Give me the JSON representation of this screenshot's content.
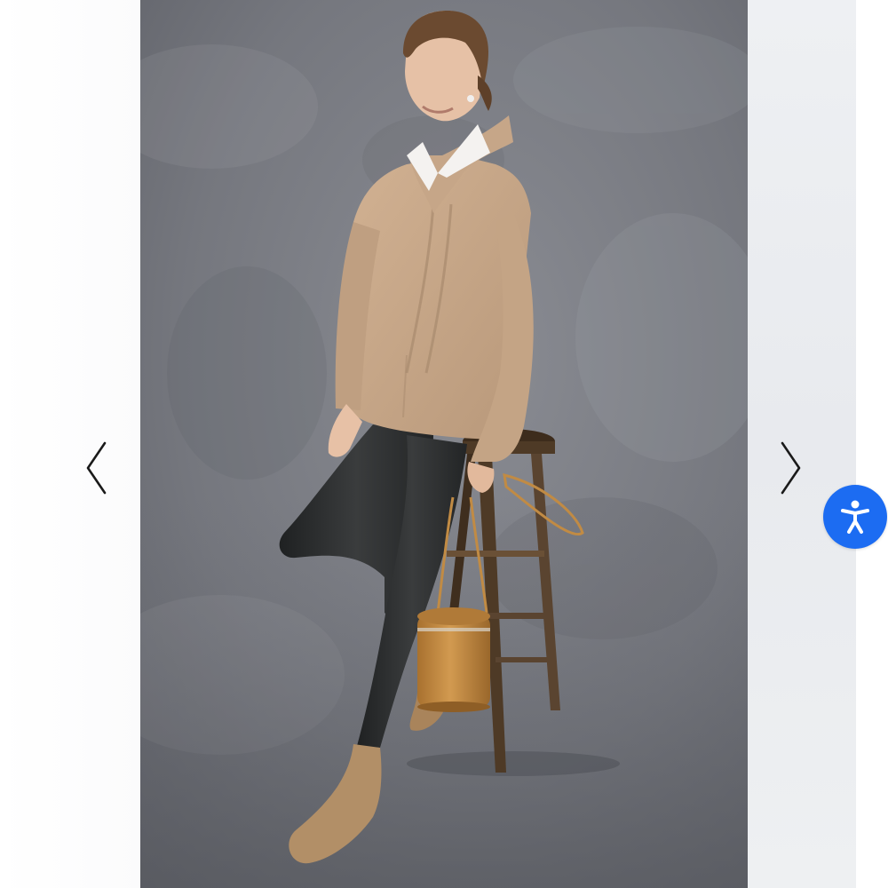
{
  "gallery": {
    "prev_icon": "chevron-left-icon",
    "next_icon": "chevron-right-icon",
    "photo": {
      "subject": "product-photo",
      "colors": {
        "backdrop": "#7d7f86",
        "sweater": "#c7a587",
        "leggings": "#2b2d2e",
        "stool": "#4e3a26",
        "bag": "#c18b44",
        "shoes": "#b28f67"
      }
    }
  },
  "accessibility": {
    "icon": "accessibility-icon",
    "color": "#1c6cf2"
  }
}
